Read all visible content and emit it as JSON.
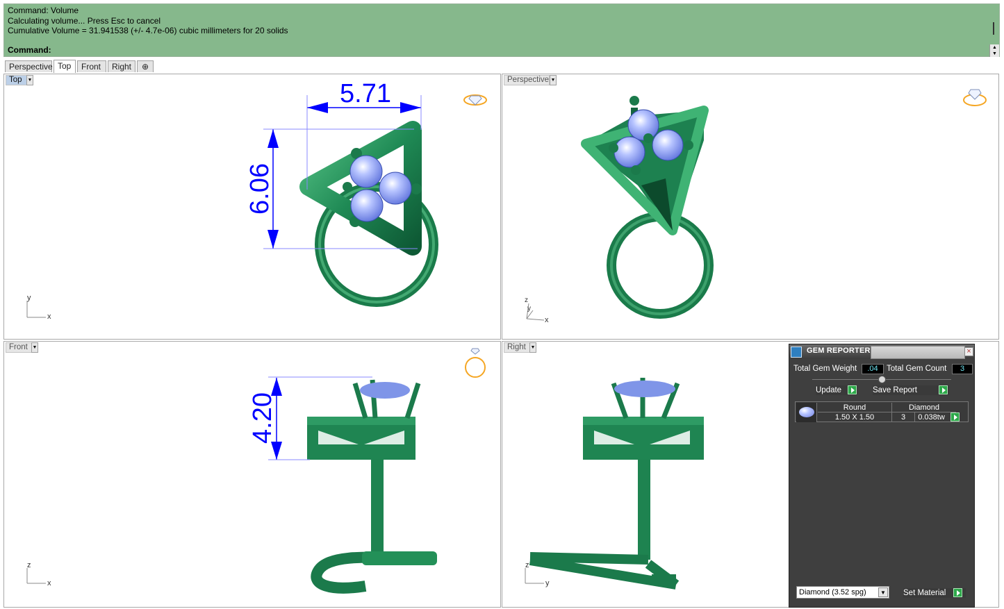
{
  "command": {
    "history": [
      "Command: Volume",
      "Calculating volume... Press Esc to cancel",
      "Cumulative Volume = 31.941538 (+/- 4.7e-06) cubic millimeters for 20 solids"
    ],
    "prompt": "Command:"
  },
  "tabs": [
    "Perspective",
    "Top",
    "Front",
    "Right"
  ],
  "active_tab": "Top",
  "viewports": {
    "top": {
      "label": "Top",
      "dim_width": "5.71",
      "dim_height": "6.06",
      "axis_a": "y",
      "axis_b": "x"
    },
    "perspective": {
      "label": "Perspective",
      "axis_a": "z",
      "axis_b": "y",
      "axis_c": "x"
    },
    "front": {
      "label": "Front",
      "dim_height": "4.20",
      "axis_a": "z",
      "axis_b": "x"
    },
    "right": {
      "label": "Right",
      "axis_a": "z",
      "axis_b": "y"
    }
  },
  "gem_reporter": {
    "title": "GEM REPORTER",
    "total_weight_label": "Total Gem Weight",
    "total_weight_value": ".04",
    "total_count_label": "Total Gem Count",
    "total_count_value": "3",
    "update_label": "Update",
    "save_report_label": "Save Report",
    "table": {
      "shape": "Round",
      "size": "1.50 X 1.50",
      "material": "Diamond",
      "count": "3",
      "weight": "0.038tw"
    },
    "material_select": "Diamond     (3.52 spg)",
    "set_material_label": "Set Material"
  },
  "colors": {
    "command_bg": "#86b88c",
    "model_green": "#1f8a55",
    "gem_blue": "#8fa6ee",
    "dimension_blue": "#0000ff",
    "active_label": "#bcd0e8"
  }
}
